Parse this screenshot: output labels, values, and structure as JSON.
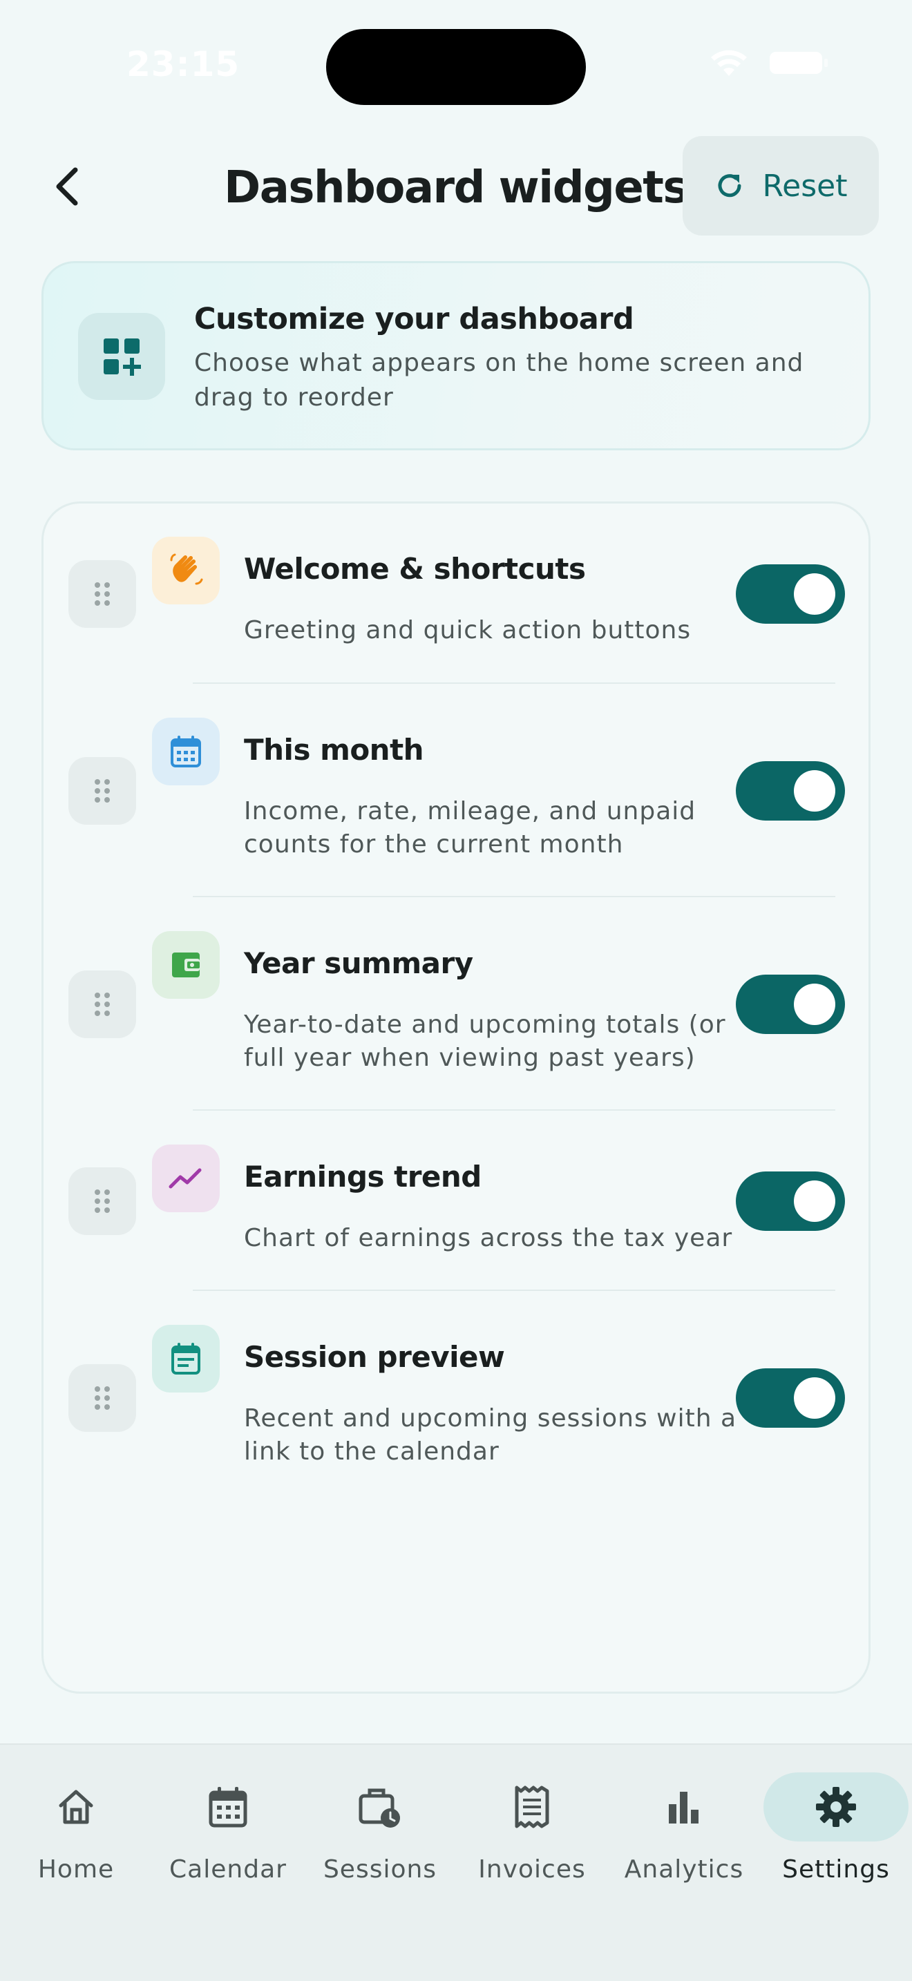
{
  "status": {
    "time": "23:15"
  },
  "header": {
    "title": "Dashboard widgets",
    "reset_label": "Reset"
  },
  "intro": {
    "title": "Customize your dashboard",
    "description": "Choose what appears on the home screen and drag to reorder"
  },
  "widgets": [
    {
      "title": "Welcome & shortcuts",
      "description": "Greeting and quick action buttons",
      "enabled": true,
      "icon": "waving-hand-icon",
      "icon_bg": "#fcefd8",
      "icon_color": "#f08a12"
    },
    {
      "title": "This month",
      "description": "Income, rate, mileage, and unpaid counts for the current month",
      "enabled": true,
      "icon": "calendar-month-icon",
      "icon_bg": "#dcedf8",
      "icon_color": "#2f8fd8"
    },
    {
      "title": "Year summary",
      "description": "Year-to-date and upcoming totals (or full year when viewing past years)",
      "enabled": true,
      "icon": "wallet-icon",
      "icon_bg": "#dff0e1",
      "icon_color": "#3fa64a"
    },
    {
      "title": "Earnings trend",
      "description": "Chart of earnings across the tax year",
      "enabled": true,
      "icon": "trending-up-icon",
      "icon_bg": "#efe1ef",
      "icon_color": "#a03aa8"
    },
    {
      "title": "Session preview",
      "description": "Recent and upcoming sessions with a link to the calendar",
      "enabled": true,
      "icon": "event-note-icon",
      "icon_bg": "#d6efea",
      "icon_color": "#129080"
    }
  ],
  "nav": [
    {
      "label": "Home",
      "icon": "home-icon",
      "active": false
    },
    {
      "label": "Calendar",
      "icon": "calendar-icon",
      "active": false
    },
    {
      "label": "Sessions",
      "icon": "briefcase-clock-icon",
      "active": false
    },
    {
      "label": "Invoices",
      "icon": "receipt-icon",
      "active": false
    },
    {
      "label": "Analytics",
      "icon": "bar-chart-icon",
      "active": false
    },
    {
      "label": "Settings",
      "icon": "gear-icon",
      "active": true
    }
  ],
  "colors": {
    "accent": "#0b6665",
    "background": "#f1f8f8"
  }
}
